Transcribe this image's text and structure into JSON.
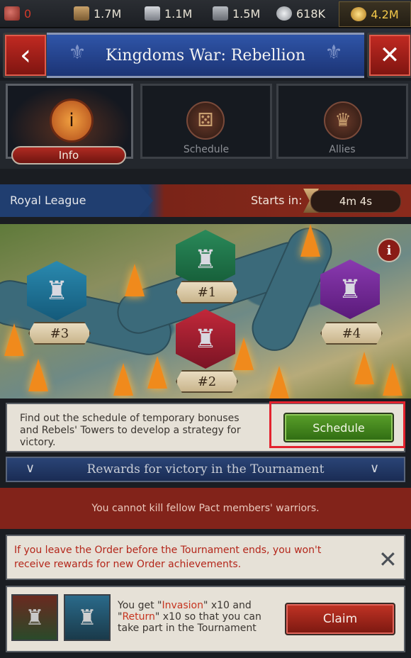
{
  "resources": [
    {
      "name": "meat",
      "icon": "meat-icon",
      "value": "0",
      "color": "#d23a2a"
    },
    {
      "name": "wood",
      "icon": "wood-icon",
      "value": "1.7M"
    },
    {
      "name": "iron",
      "icon": "iron-icon",
      "value": "1.1M"
    },
    {
      "name": "stone",
      "icon": "stone-icon",
      "value": "1.5M"
    },
    {
      "name": "silver",
      "icon": "silver-coins-icon",
      "value": "618K"
    },
    {
      "name": "gold",
      "icon": "gold-coins-icon",
      "value": "4.2M",
      "color": "#f4c94a"
    }
  ],
  "header": {
    "title": "Kingdoms War: Rebellion",
    "back_icon": "chevron-left-icon",
    "close_icon": "close-icon"
  },
  "tabs": [
    {
      "label": "Info",
      "icon": "info-icon",
      "active": true
    },
    {
      "label": "Schedule",
      "icon": "dice-icon",
      "active": false
    },
    {
      "label": "Allies",
      "icon": "crown-icon",
      "active": false
    }
  ],
  "league": {
    "name": "Royal League",
    "starts_label": "Starts in:",
    "timer": "4m 4s",
    "timer_icon": "hourglass-icon"
  },
  "map": {
    "ranks": [
      "#1",
      "#2",
      "#3",
      "#4"
    ],
    "info_glyph": "i"
  },
  "schedule_notice": {
    "text": "Find out the schedule of temporary bonuses and Rebels' Towers to develop a strategy for victory.",
    "button": "Schedule"
  },
  "rewards": {
    "title": "Rewards for victory in the Tournament"
  },
  "pact_message": "You cannot kill fellow Pact members' warriors.",
  "order_warning": "If you leave the Order before the Tournament ends, you won't receive rewards for new Order achievements.",
  "claim": {
    "text_prefix": "You get \"",
    "invasion": "Invasion",
    "mid1": "\" x10 and \"",
    "return": "Return",
    "mid2": "\" x10 so that you can take part in the Tournament",
    "button": "Claim"
  },
  "colors": {
    "accent_red": "#b02a22",
    "accent_blue": "#2f55a8",
    "button_green": "#4a8f22",
    "highlight": "#e3232e"
  }
}
